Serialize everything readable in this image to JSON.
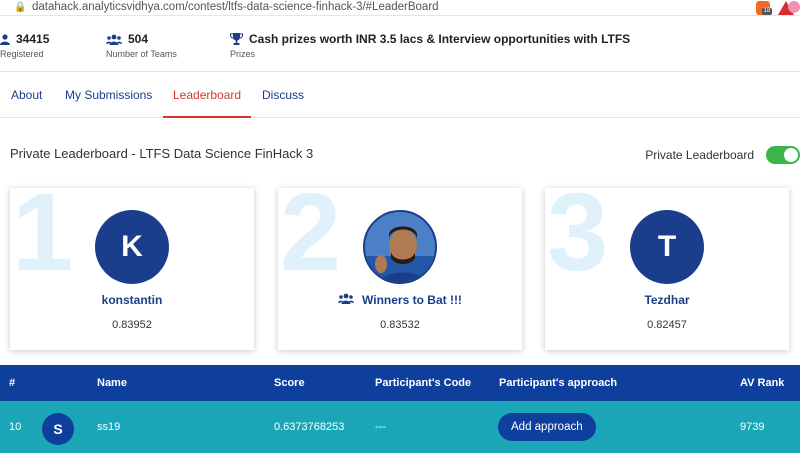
{
  "browser": {
    "url": "datahack.analyticsvidhya.com/contest/ltfs-data-science-finhack-3/#LeaderBoard",
    "ext_badge": "18"
  },
  "stats": {
    "registered": {
      "value": "34415",
      "label": "Registered"
    },
    "teams": {
      "value": "504",
      "label": "Number of Teams"
    },
    "prizes": {
      "value": "Cash prizes worth INR 3.5 lacs & Interview opportunities with LTFS",
      "label": "Prizes"
    }
  },
  "tabs": [
    {
      "label": "About"
    },
    {
      "label": "My Submissions"
    },
    {
      "label": "Leaderboard"
    },
    {
      "label": "Discuss"
    }
  ],
  "leaderboard": {
    "title": "Private Leaderboard - LTFS Data Science FinHack 3",
    "toggle_label": "Private Leaderboard",
    "toggle_on": true
  },
  "podium": [
    {
      "rank": "1",
      "initial": "K",
      "name": "konstantin",
      "score": "0.83952",
      "team": false
    },
    {
      "rank": "2",
      "initial": "",
      "name": "Winners to Bat !!!",
      "score": "0.83532",
      "team": true
    },
    {
      "rank": "3",
      "initial": "T",
      "name": "Tezdhar",
      "score": "0.82457",
      "team": false
    }
  ],
  "table": {
    "headers": [
      "#",
      "Name",
      "Score",
      "Participant's Code",
      "Participant's approach",
      "AV Rank"
    ],
    "row": {
      "rank": "10",
      "initial": "S",
      "name": "ss19",
      "score": "0.6373768253",
      "code": "---",
      "approach_button": "Add approach",
      "av_rank": "9739"
    }
  },
  "colors": {
    "primary": "#1a3e8c",
    "active_tab": "#d9362b",
    "row_highlight": "#1aa6b7",
    "toggle_on": "#3bb54a"
  }
}
